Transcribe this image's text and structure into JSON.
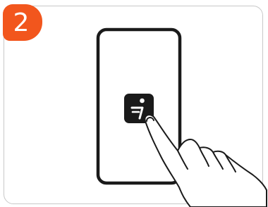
{
  "step": {
    "number": "2"
  },
  "colors": {
    "badge": "#f2561d",
    "outline": "#1a1a1a",
    "border": "#c8c8c8"
  },
  "icons": {
    "phone": "phone-outline-icon",
    "app": "segway-ninebot-app-icon",
    "hand": "tapping-hand-icon"
  }
}
